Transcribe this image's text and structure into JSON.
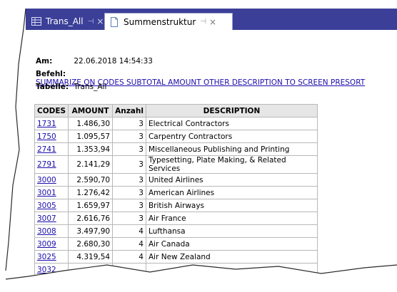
{
  "tabs": [
    {
      "label": "Trans_All",
      "icon": "table-icon",
      "active": false
    },
    {
      "label": "Summenstruktur",
      "icon": "document-icon",
      "active": true
    }
  ],
  "meta": {
    "am_label": "Am:",
    "am_value": "22.06.2018 14:54:33",
    "befehl_label": "Befehl:",
    "befehl_value": "SUMMARIZE ON CODES SUBTOTAL AMOUNT OTHER DESCRIPTION TO SCREEN PRESORT",
    "tabelle_label": "Tabelle:",
    "tabelle_value": "Trans_All"
  },
  "table": {
    "headers": [
      "CODES",
      "AMOUNT",
      "Anzahl",
      "DESCRIPTION"
    ],
    "rows": [
      {
        "code": "1731",
        "amount": "1.486,30",
        "count": "3",
        "description": "Electrical Contractors"
      },
      {
        "code": "1750",
        "amount": "1.095,57",
        "count": "3",
        "description": "Carpentry Contractors"
      },
      {
        "code": "2741",
        "amount": "1.353,94",
        "count": "3",
        "description": "Miscellaneous Publishing and Printing"
      },
      {
        "code": "2791",
        "amount": "2.141,29",
        "count": "3",
        "description": "Typesetting, Plate Making, & Related Services"
      },
      {
        "code": "3000",
        "amount": "2.590,70",
        "count": "3",
        "description": "United Airlines"
      },
      {
        "code": "3001",
        "amount": "1.276,42",
        "count": "3",
        "description": "American Airlines"
      },
      {
        "code": "3005",
        "amount": "1.659,97",
        "count": "3",
        "description": "British Airways"
      },
      {
        "code": "3007",
        "amount": "2.616,76",
        "count": "3",
        "description": "Air France"
      },
      {
        "code": "3008",
        "amount": "3.497,90",
        "count": "4",
        "description": "Lufthansa"
      },
      {
        "code": "3009",
        "amount": "2.680,30",
        "count": "4",
        "description": "Air Canada"
      },
      {
        "code": "3025",
        "amount": "4.319,54",
        "count": "4",
        "description": "Air New Zealand"
      },
      {
        "code": "3032",
        "amount": "",
        "count": "",
        "description": ""
      }
    ]
  },
  "colors": {
    "tabstrip": "#3b3f98",
    "link": "#1a0dab"
  }
}
